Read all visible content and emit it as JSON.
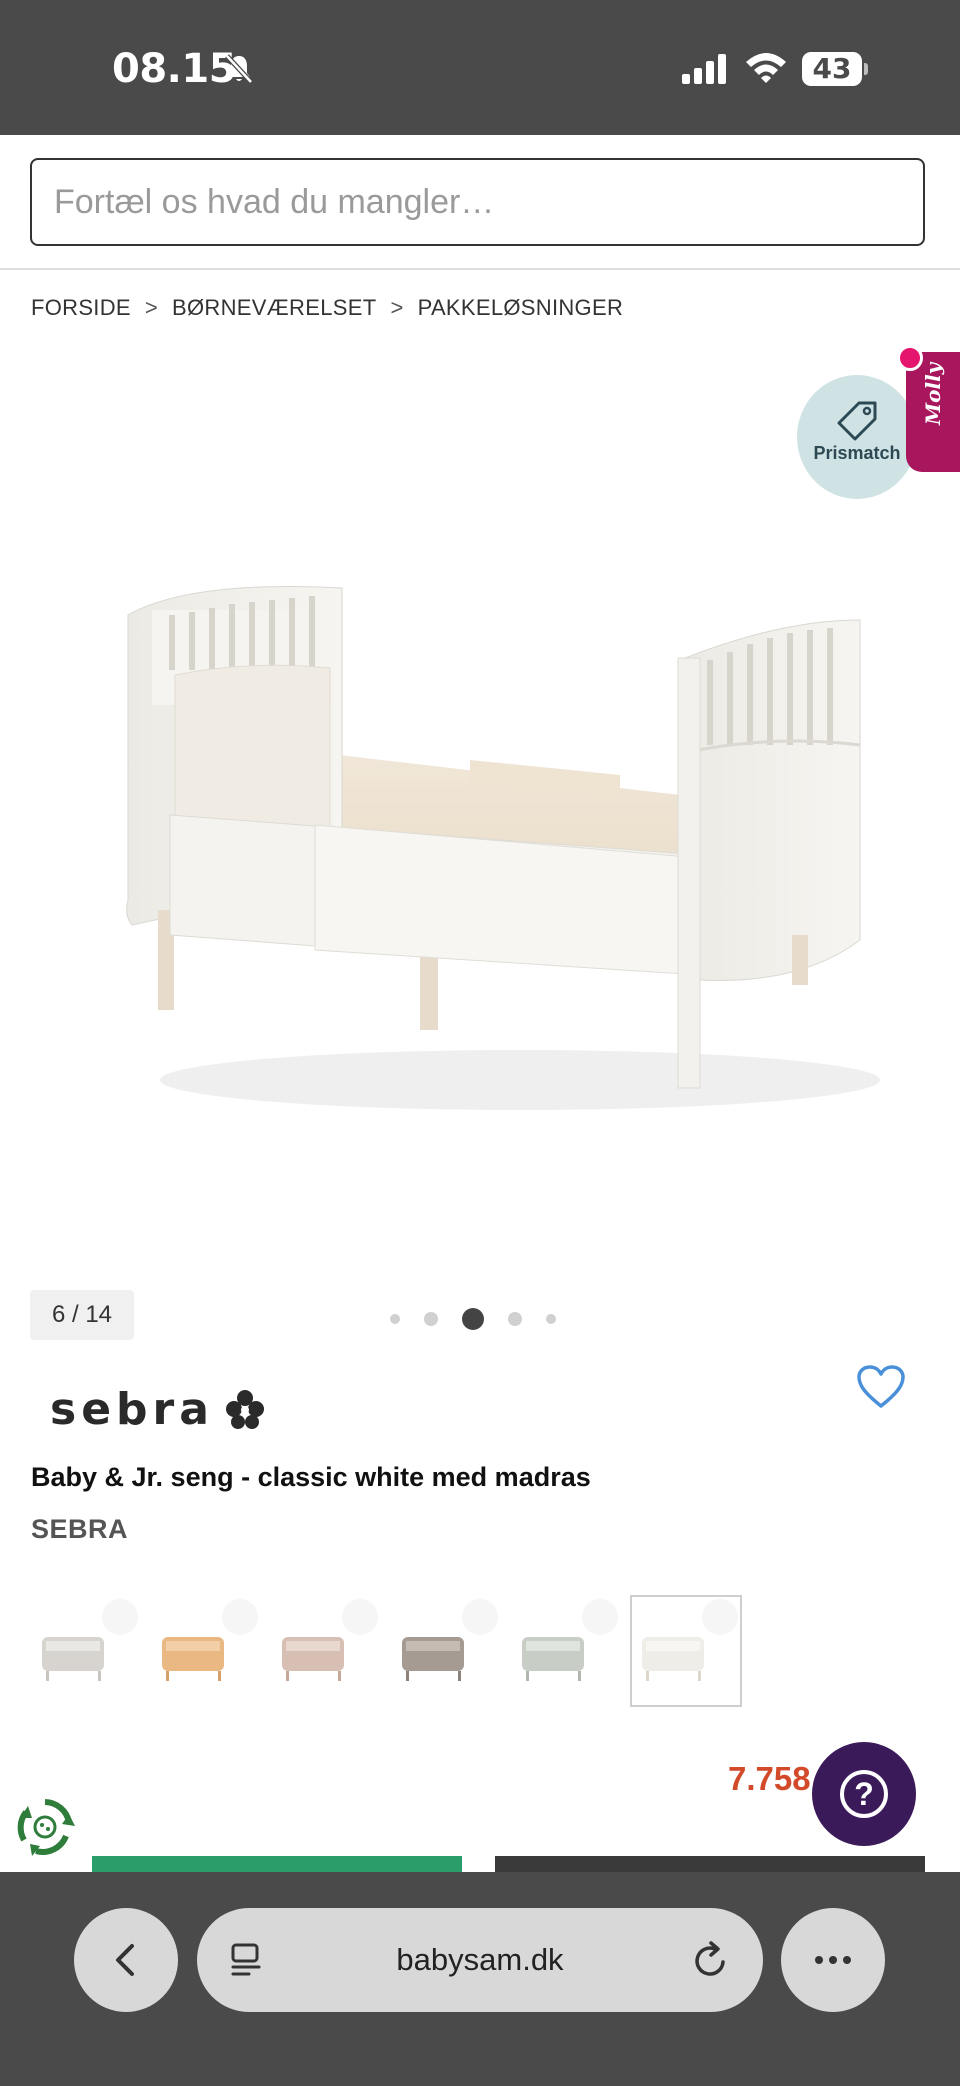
{
  "status_bar": {
    "time": "08.15",
    "battery": "43",
    "icons": [
      "bell-slash-icon",
      "signal-icon",
      "wifi-icon",
      "battery-icon"
    ]
  },
  "search": {
    "placeholder": "Fortæl os hvad du mangler…",
    "value": ""
  },
  "breadcrumb": {
    "items": [
      "FORSIDE",
      "BØRNEVÆRELSET",
      "PAKKELØSNINGER"
    ],
    "separator": ">"
  },
  "badges": {
    "prismatch": "Prismatch",
    "molly": "Molly"
  },
  "gallery": {
    "counter": "6 / 14"
  },
  "product": {
    "brand_logo": "sebra",
    "title": "Baby & Jr. seng - classic white med madras",
    "brand": "SEBRA",
    "price": "7.758",
    "variants": [
      {
        "color": "#d7d4cf"
      },
      {
        "color": "#e9b883"
      },
      {
        "color": "#d8bfb3"
      },
      {
        "color": "#a69b93"
      },
      {
        "color": "#c8cdc6"
      },
      {
        "color": "#efede8"
      }
    ]
  },
  "browser": {
    "url": "babysam.dk"
  },
  "colors": {
    "status_bg": "#4a4a4a",
    "price": "#d24a2a",
    "molly": "#a8175e",
    "help": "#3b1a5a",
    "heart": "#4a90d9",
    "green_button": "#2a9d6a"
  }
}
